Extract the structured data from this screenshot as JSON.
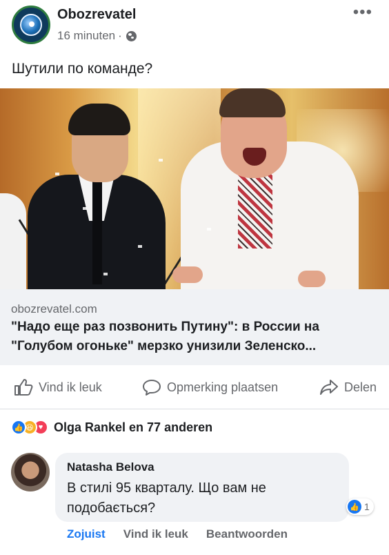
{
  "post": {
    "page_name": "Obozrevatel",
    "time": "16 minuten",
    "separator": "·",
    "privacy_icon": "globe-icon",
    "more_icon": "more-icon",
    "text": "Шутили по команде?"
  },
  "link": {
    "domain": "obozrevatel.com",
    "title": "\"Надо еще раз позвонить Путину\": в России на \"Голубом огоньке\" мерзко унизили Зеленско..."
  },
  "actions": {
    "like": "Vind ik leuk",
    "comment": "Opmerking plaatsen",
    "share": "Delen"
  },
  "reactions": {
    "icons": [
      "like-reaction-icon",
      "haha-reaction-icon",
      "love-reaction-icon"
    ],
    "summary": "Olga Rankel en 77 anderen"
  },
  "comment": {
    "author": "Natasha Belova",
    "text": "В стилі 95 кварталу. Що вам не подобається?",
    "like_count": "1",
    "time": "Zojuist",
    "like_label": "Vind ik leuk",
    "reply_label": "Beantwoorden"
  },
  "colors": {
    "accent": "#1877f2",
    "text": "#1c1e21",
    "secondary_text": "#65676b",
    "link_box_bg": "#f0f2f5"
  }
}
